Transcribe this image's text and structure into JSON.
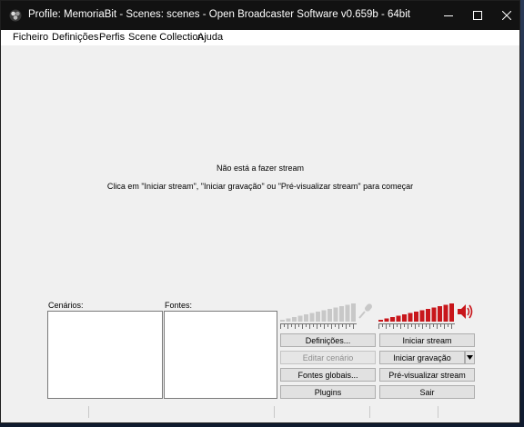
{
  "window": {
    "title": "Profile: MemoriaBit - Scenes: scenes - Open Broadcaster Software v0.659b - 64bit",
    "controls": {
      "minimize": "—",
      "maximize": "☐",
      "close": "✕"
    }
  },
  "menu": {
    "items": [
      "Ficheiro",
      "Definições",
      "Perfis",
      "Scene Collection",
      "Ajuda"
    ]
  },
  "preview": {
    "status": "Não está a fazer stream",
    "hint": "Clica em \"Iniciar stream\", \"Iniciar gravação\" ou \"Pré-visualizar stream\" para começar"
  },
  "scenes": {
    "label": "Cenários:"
  },
  "sources": {
    "label": "Fontes:"
  },
  "audio": {
    "mic_icon": "microphone-icon",
    "speaker_icon": "speaker-icon",
    "mic_color": "#c8c8c8",
    "desktop_color": "#c8161b",
    "mic_level": 1.0,
    "desktop_level": 1.0
  },
  "buttons": {
    "settings": "Definições...",
    "edit_scene": "Editar cenário",
    "global_sources": "Fontes globais...",
    "plugins": "Plugins",
    "start_stream": "Iniciar stream",
    "start_recording": "Iniciar gravação",
    "preview_stream": "Pré-visualizar stream",
    "exit": "Sair"
  }
}
